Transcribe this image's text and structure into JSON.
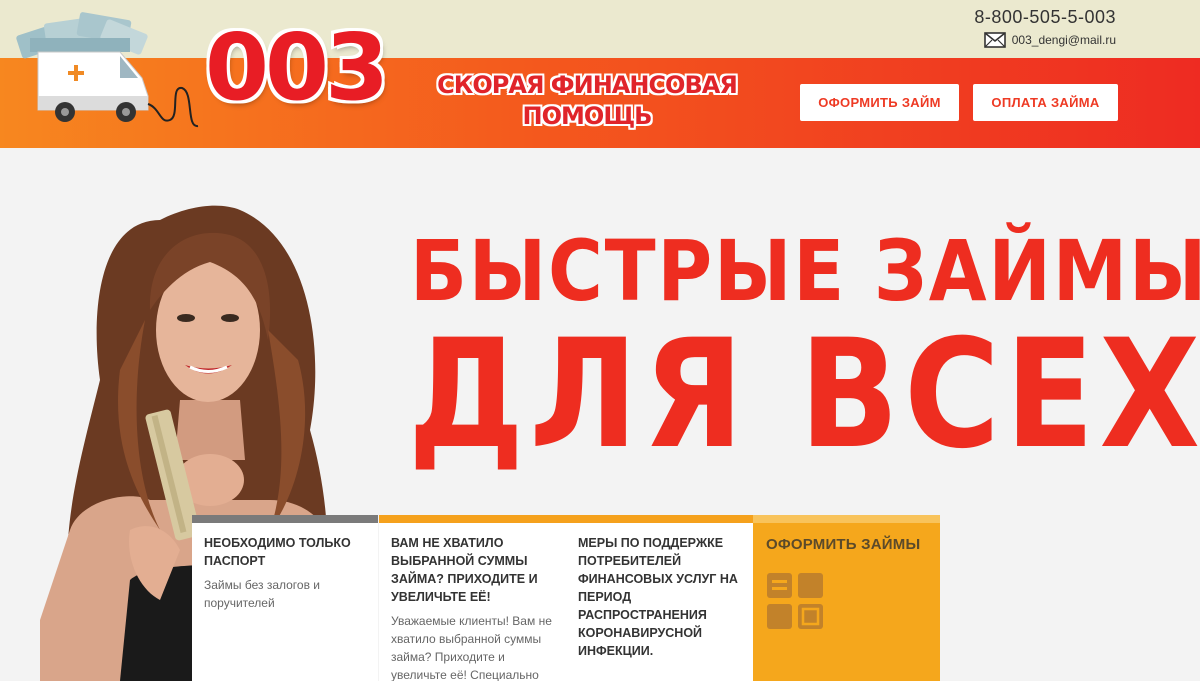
{
  "header": {
    "phone": "8-800-505-5-003",
    "email": "003_dengi@mail.ru",
    "logo_number": "003",
    "slogan_line1": "СКОРАЯ ФИНАНСОВАЯ",
    "slogan_line2": "ПОМОЩЬ",
    "apply_button": "ОФОРМИТЬ ЗАЙМ",
    "pay_button": "ОПЛАТА ЗАЙМА"
  },
  "hero": {
    "headline_line1": "БЫСТРЫЕ ЗАЙМЫ",
    "headline_line2": "ДЛЯ ВСЕХ"
  },
  "cards": [
    {
      "title": "НЕОБХОДИМО ТОЛЬКО ПАСПОРТ",
      "text": "Займы без залогов и поручителей",
      "bar_color": "#7a7a7a"
    },
    {
      "title": "ВАМ НЕ ХВАТИЛО ВЫБРАННОЙ СУММЫ ЗАЙМА? ПРИХОДИТЕ И УВЕЛИЧЬТЕ ЕЁ!",
      "text": "Уважаемые клиенты! Вам не хватило выбранной суммы займа? Приходите и увеличьте её! Специально",
      "bar_color": "#f5a11c"
    },
    {
      "title": "МЕРЫ ПО ПОДДЕРЖКЕ ПОТРЕБИТЕЛЕЙ ФИНАНСОВЫХ УСЛУГ НА ПЕРИОД РАСПРОСТРАНЕНИЯ КОРОНАВИРУСНОЙ ИНФЕКЦИИ.",
      "text": "",
      "bar_color": "#f5a11c"
    }
  ],
  "cta_card": {
    "title": "ОФОРМИТЬ ЗАЙМЫ",
    "icon": "form-grid-icon",
    "bg_color": "#f5a71c"
  },
  "colors": {
    "brand_red": "#ee2d20",
    "brand_orange": "#f7871f",
    "topbar": "#ebe9cf"
  }
}
